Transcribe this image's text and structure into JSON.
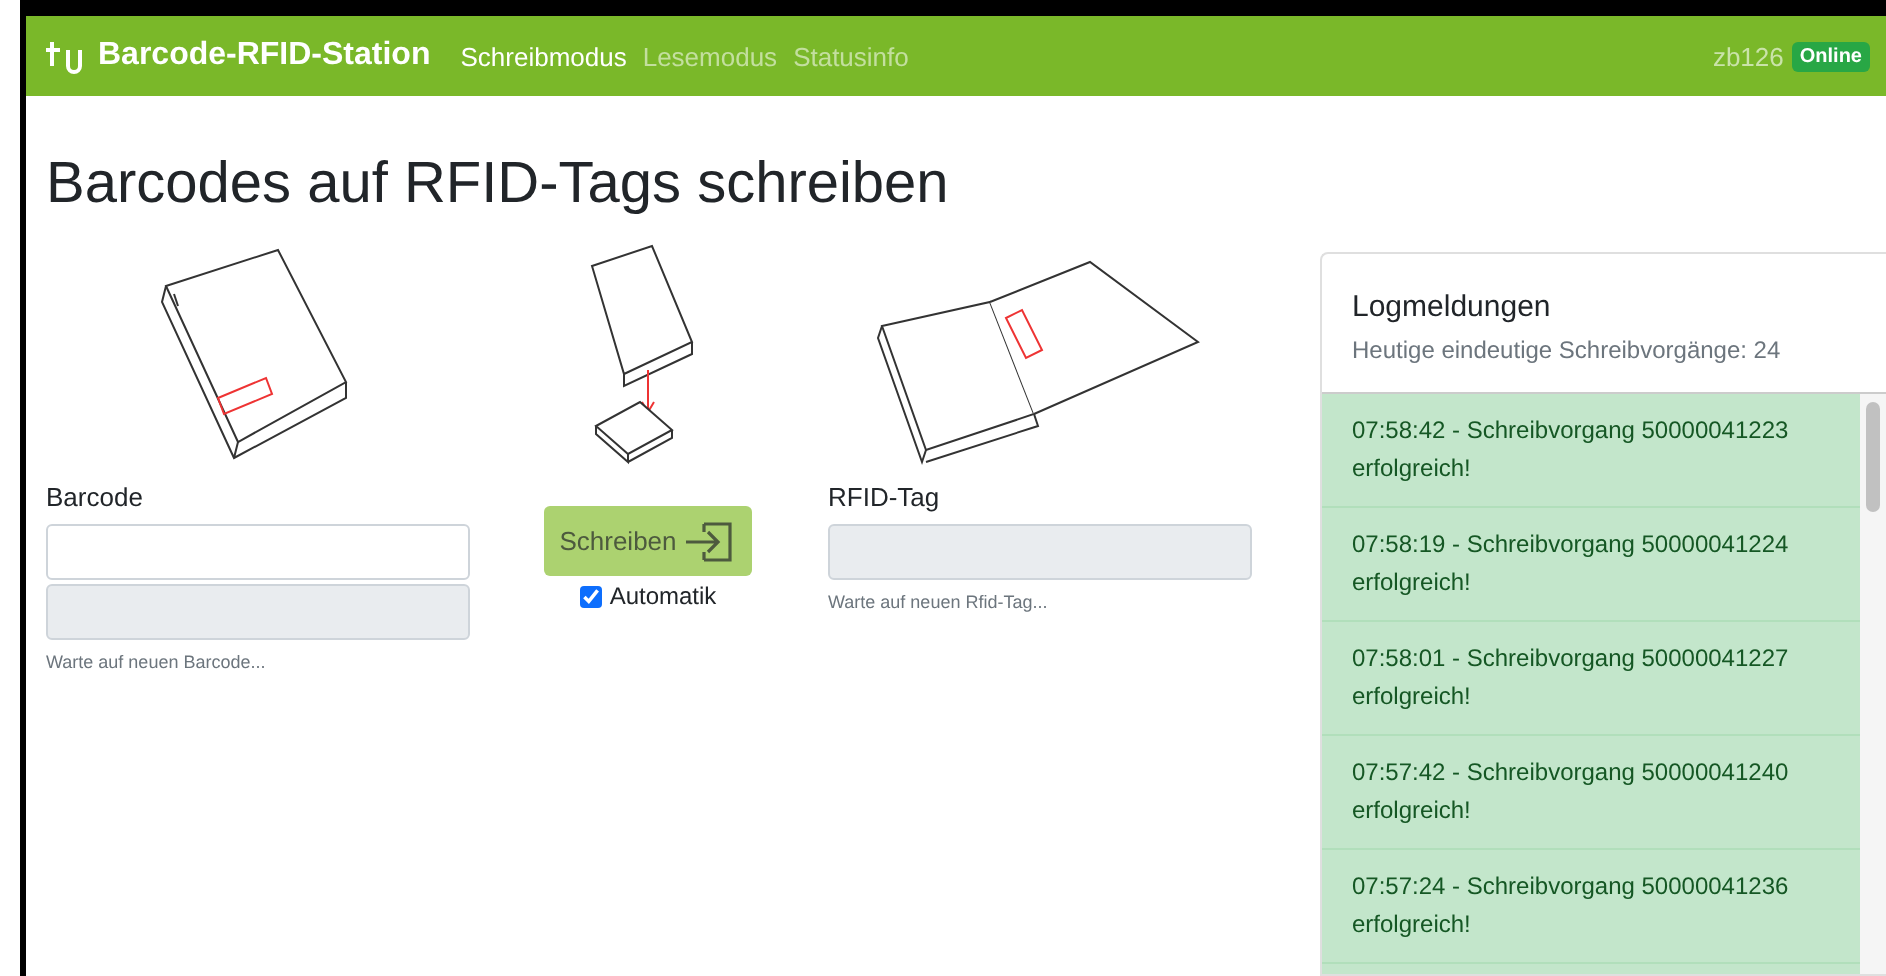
{
  "navbar": {
    "brand": "Barcode-RFID-Station",
    "links": [
      {
        "label": "Schreibmodus",
        "selected": true
      },
      {
        "label": "Lesemodus",
        "selected": false
      },
      {
        "label": "Statusinfo",
        "selected": false
      }
    ],
    "user": "zb126",
    "status_badge": "Online"
  },
  "heading": "Barcodes auf RFID-Tags schreiben",
  "barcode": {
    "label": "Barcode",
    "hint": "Warte auf neuen Barcode..."
  },
  "write_button": {
    "label": "Schreiben",
    "disabled": true
  },
  "automatik": {
    "label": "Automatik",
    "checked": true
  },
  "rfid": {
    "label": "RFID-Tag",
    "hint": "Warte auf neuen Rfid-Tag..."
  },
  "log": {
    "title": "Logmeldungen",
    "subtitle": "Heutige eindeutige Schreibvorgänge: 24",
    "entries": [
      {
        "text": "07:58:42 - Schreibvorgang 50000041223 erfolgreich!"
      },
      {
        "text": "07:58:19 - Schreibvorgang 50000041224 erfolgreich!"
      },
      {
        "text": "07:58:01 - Schreibvorgang 50000041227 erfolgreich!"
      },
      {
        "text": "07:57:42 - Schreibvorgang 50000041240 erfolgreich!"
      },
      {
        "text": "07:57:24 - Schreibvorgang 50000041236 erfolgreich!"
      }
    ]
  }
}
